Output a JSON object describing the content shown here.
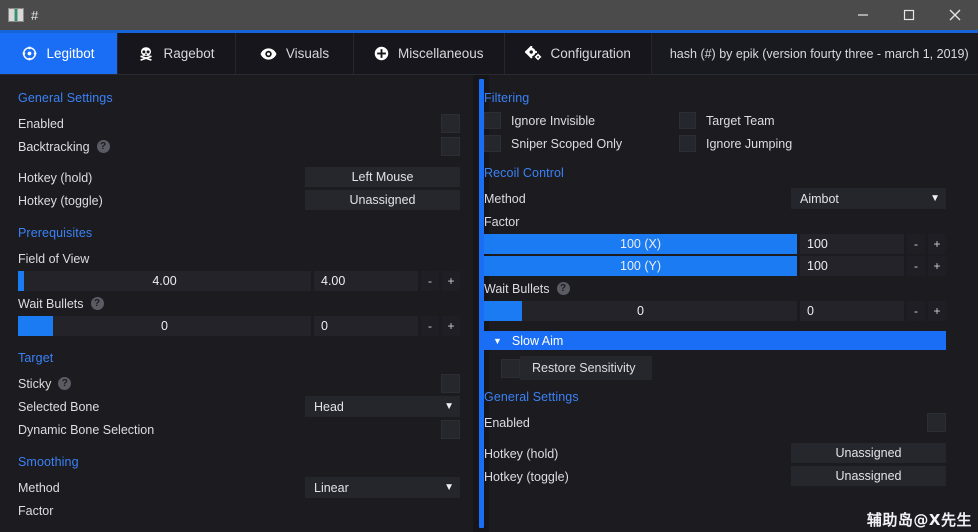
{
  "window": {
    "title": "#",
    "icon": "app-icon",
    "controls": {
      "minimize": "minimize",
      "maximize": "maximize",
      "close": "close"
    }
  },
  "tabs": [
    {
      "label": "Legitbot",
      "icon": "crosshair-icon",
      "active": true
    },
    {
      "label": "Ragebot",
      "icon": "skull-icon",
      "active": false
    },
    {
      "label": "Visuals",
      "icon": "eye-icon",
      "active": false
    },
    {
      "label": "Miscellaneous",
      "icon": "plus-circle-icon",
      "active": false
    },
    {
      "label": "Configuration",
      "icon": "gears-icon",
      "active": false
    }
  ],
  "version_text": "hash (#) by epik (version fourty three - march 1, 2019)",
  "left": {
    "general": {
      "title": "General Settings",
      "enabled_label": "Enabled",
      "backtracking_label": "Backtracking",
      "hotkey_hold_label": "Hotkey (hold)",
      "hotkey_hold_value": "Left Mouse",
      "hotkey_toggle_label": "Hotkey (toggle)",
      "hotkey_toggle_value": "Unassigned"
    },
    "prerequisites": {
      "title": "Prerequisites",
      "fov_label": "Field of View",
      "fov_slider_text": "4.00",
      "fov_value": "4.00",
      "fov_fill_pct": 2,
      "wait_bullets_label": "Wait Bullets",
      "wait_bullets_slider_text": "0",
      "wait_bullets_value": "0",
      "wait_bullets_fill_pct": 12
    },
    "target": {
      "title": "Target",
      "sticky_label": "Sticky",
      "selected_bone_label": "Selected Bone",
      "selected_bone_value": "Head",
      "dynamic_bone_label": "Dynamic Bone Selection"
    },
    "smoothing": {
      "title": "Smoothing",
      "method_label": "Method",
      "method_value": "Linear",
      "factor_label": "Factor"
    }
  },
  "right": {
    "filtering": {
      "title": "Filtering",
      "items": [
        "Ignore Invisible",
        "Target Team",
        "Sniper Scoped Only",
        "Ignore Jumping"
      ]
    },
    "recoil": {
      "title": "Recoil Control",
      "method_label": "Method",
      "method_value": "Aimbot",
      "factor_label": "Factor",
      "x_slider_text": "100 (X)",
      "x_value": "100",
      "x_fill_pct": 100,
      "y_slider_text": "100 (Y)",
      "y_value": "100",
      "y_fill_pct": 100,
      "wait_bullets_label": "Wait Bullets",
      "wait_bullets_slider_text": "0",
      "wait_bullets_value": "0",
      "wait_bullets_fill_pct": 12
    },
    "slow_aim": {
      "title": "Slow Aim",
      "restore_sensitivity_label": "Restore Sensitivity"
    },
    "general": {
      "title": "General Settings",
      "enabled_label": "Enabled",
      "hotkey_hold_label": "Hotkey (hold)",
      "hotkey_hold_value": "Unassigned",
      "hotkey_toggle_label": "Hotkey (toggle)",
      "hotkey_toggle_value": "Unassigned"
    }
  },
  "watermark": "辅助岛@X先生",
  "colors": {
    "accent": "#1a6ef5",
    "section_heading": "#3b82f6",
    "background": "#1b1b20",
    "titlebar": "#4b4b4b"
  },
  "steppers": {
    "minus": "-",
    "plus": "+"
  },
  "caret_down": "▼"
}
